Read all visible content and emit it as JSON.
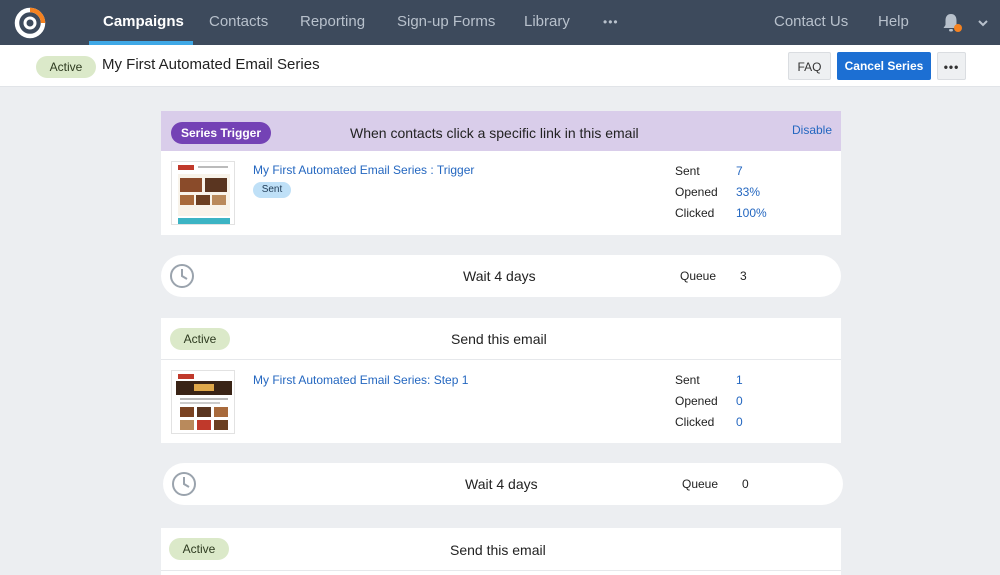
{
  "nav": {
    "items": [
      "Campaigns",
      "Contacts",
      "Reporting",
      "Sign-up Forms",
      "Library"
    ],
    "more": "•••",
    "right": [
      "Contact Us",
      "Help"
    ]
  },
  "header": {
    "status": "Active",
    "title": "My First Automated Email Series",
    "faq_label": "FAQ",
    "cancel_label": "Cancel Series",
    "more_label": "•••"
  },
  "trigger": {
    "badge": "Series Trigger",
    "heading": "When contacts click a specific link in this email",
    "disable_label": "Disable",
    "email_name": "My First Automated Email Series : Trigger",
    "email_status": "Sent",
    "stats": [
      {
        "label": "Sent",
        "value": "7"
      },
      {
        "label": "Opened",
        "value": "33%"
      },
      {
        "label": "Clicked",
        "value": "100%"
      }
    ]
  },
  "waits": [
    {
      "text": "Wait 4 days",
      "queue_label": "Queue",
      "queue_value": "3"
    },
    {
      "text": "Wait 4 days",
      "queue_label": "Queue",
      "queue_value": "0"
    }
  ],
  "steps": [
    {
      "status": "Active",
      "heading": "Send this email",
      "email_name": "My First Automated Email Series: Step 1",
      "stats": [
        {
          "label": "Sent",
          "value": "1"
        },
        {
          "label": "Opened",
          "value": "0"
        },
        {
          "label": "Clicked",
          "value": "0"
        }
      ]
    },
    {
      "status": "Active",
      "heading": "Send this email"
    }
  ],
  "colors": {
    "nav_bg": "#3d4a5c",
    "accent_blue": "#1c6fd3",
    "trigger_purple": "#7442b5",
    "logo_orange": "#f58220",
    "active_green": "#dbe9c9"
  }
}
